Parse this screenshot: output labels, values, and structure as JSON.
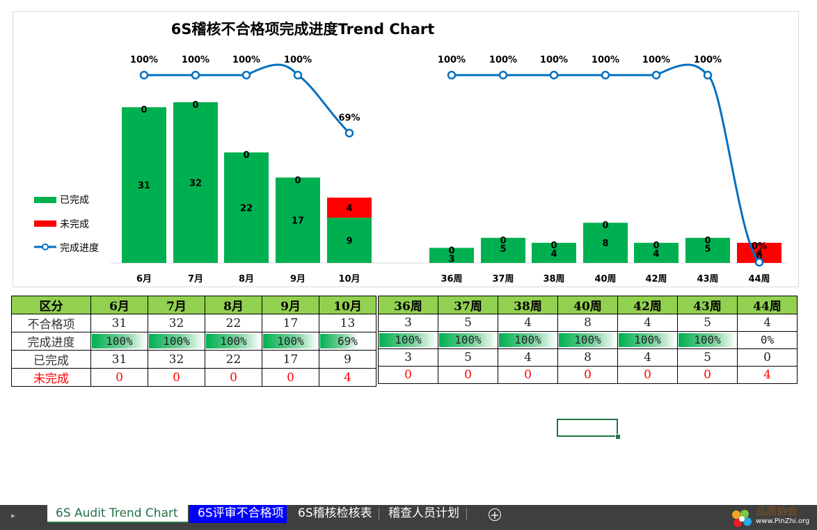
{
  "chart_data": [
    {
      "type": "bar",
      "title": "6S稽核不合格项完成进度Trend Chart",
      "categories": [
        "6月",
        "7月",
        "8月",
        "9月",
        "10月"
      ],
      "series": [
        {
          "name": "已完成",
          "values": [
            31,
            32,
            22,
            17,
            9
          ]
        },
        {
          "name": "未完成",
          "values": [
            0,
            0,
            0,
            0,
            4
          ]
        },
        {
          "name": "完成进度",
          "type": "line",
          "values": [
            100,
            100,
            100,
            100,
            69
          ],
          "labels": [
            "100%",
            "100%",
            "100%",
            "100%",
            "69%"
          ]
        }
      ],
      "legend": "left"
    },
    {
      "type": "bar",
      "categories": [
        "36周",
        "37周",
        "38周",
        "40周",
        "42周",
        "43周",
        "44周"
      ],
      "series": [
        {
          "name": "已完成",
          "values": [
            3,
            5,
            4,
            8,
            4,
            5,
            0
          ]
        },
        {
          "name": "未完成",
          "values": [
            0,
            0,
            0,
            0,
            0,
            0,
            4
          ]
        },
        {
          "name": "完成进度",
          "type": "line",
          "values": [
            100,
            100,
            100,
            100,
            100,
            100,
            0
          ],
          "labels": [
            "100%",
            "100%",
            "100%",
            "100%",
            "100%",
            "100%",
            "0%"
          ]
        }
      ]
    }
  ],
  "colors": {
    "done": "#00b050",
    "undone": "#ff0000",
    "line": "#0070c0",
    "header": "#92d050"
  },
  "legend": {
    "done": "已完成",
    "undone": "未完成",
    "progress": "完成进度"
  },
  "table_left": {
    "header": [
      "区分",
      "6月",
      "7月",
      "8月",
      "9月",
      "10月"
    ],
    "rows": [
      {
        "label": "不合格项",
        "values": [
          "31",
          "32",
          "22",
          "17",
          "13"
        ]
      },
      {
        "label": "完成进度",
        "values": [
          "100%",
          "100%",
          "100%",
          "100%",
          "69%"
        ],
        "fill": [
          1,
          1,
          1,
          1,
          0.69
        ]
      },
      {
        "label": "已完成",
        "values": [
          "31",
          "32",
          "22",
          "17",
          "9"
        ]
      },
      {
        "label": "未完成",
        "values": [
          "0",
          "0",
          "0",
          "0",
          "4"
        ]
      }
    ]
  },
  "table_right": {
    "header": [
      "36周",
      "37周",
      "38周",
      "40周",
      "42周",
      "43周",
      "44周"
    ],
    "rows": [
      {
        "values": [
          "3",
          "5",
          "4",
          "8",
          "4",
          "5",
          "4"
        ]
      },
      {
        "values": [
          "100%",
          "100%",
          "100%",
          "100%",
          "100%",
          "100%",
          "0%"
        ],
        "fill": [
          1,
          1,
          1,
          1,
          1,
          1,
          0
        ]
      },
      {
        "values": [
          "3",
          "5",
          "4",
          "8",
          "4",
          "5",
          "0"
        ]
      },
      {
        "values": [
          "0",
          "0",
          "0",
          "0",
          "0",
          "0",
          "4"
        ]
      }
    ]
  },
  "tabs": [
    "6S Audit Trend Chart",
    "6S评审不合格项",
    "6S稽核检核表",
    "稽查人员计划"
  ],
  "logo": {
    "name": "品质协会",
    "url": "www.PinZhi.org"
  }
}
